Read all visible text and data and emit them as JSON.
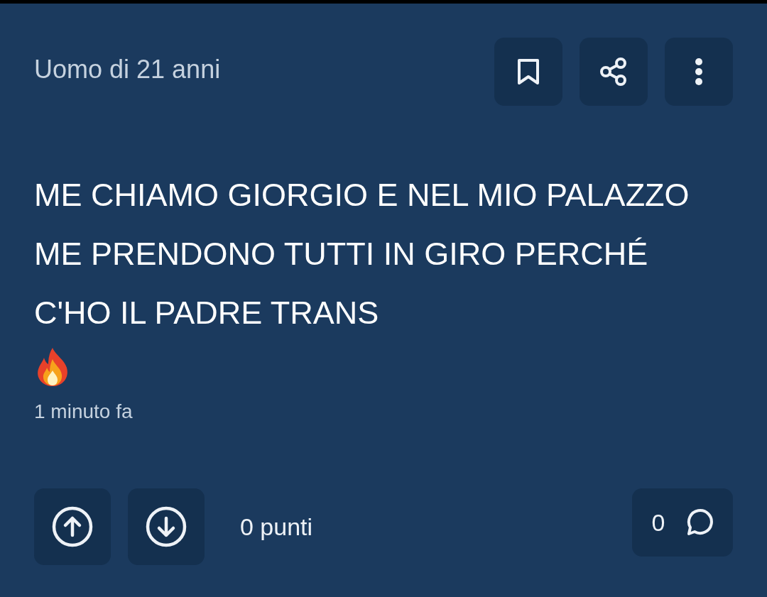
{
  "post": {
    "author": "Uomo di 21 anni",
    "body": "ME CHIAMO GIORGIO E NEL MIO PALAZZO ME PRENDONO TUTTI IN GIRO PERCHÉ C'HO IL PADRE TRANS",
    "time": "1 minuto fa"
  },
  "votes": {
    "score": "0 punti"
  },
  "comments": {
    "count": "0"
  }
}
